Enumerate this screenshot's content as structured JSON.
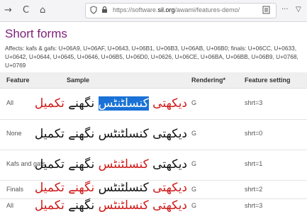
{
  "browser": {
    "back_glyph": "→",
    "reload_glyph": "C",
    "home_glyph": "⌂",
    "url_prefix": "https://software.",
    "url_domain": "sil.org",
    "url_path": "/awami/features-demo/",
    "menu_glyph": "···",
    "pocket_glyph": "▽"
  },
  "page": {
    "title": "Short forms",
    "affects": "Affects: kafs & gafs: U+06A9, U+06AF, U+0643, U+06B1, U+06B3, U+06AB, U+06B0; finals: U+06CC, U+0633, U+0642, U+0644, U+0645, U+0646, U+06B5, U+06D0, U+0626, U+06CE, U+06BA, U+06BB, U+06B9, U+0768, U+0769"
  },
  "table": {
    "headers": [
      "Feature",
      "Sample",
      "Rendering*",
      "Feature setting"
    ],
    "rows": [
      {
        "feature": "All",
        "rendering": "G",
        "setting": "shrt=3"
      },
      {
        "feature": "None",
        "rendering": "G",
        "setting": "shrt=0"
      },
      {
        "feature": "Kafs and gafs",
        "rendering": "G",
        "setting": "shrt=1"
      },
      {
        "feature": "Finals",
        "rendering": "G",
        "setting": "shrt=2"
      },
      {
        "feature": "All",
        "rendering": "G",
        "setting": "shrt=3"
      }
    ]
  },
  "sample": {
    "word1": "دیکھتی",
    "word2": "کنسلٹنٹس",
    "word3": "نگھنے",
    "word4": "تکمیل"
  },
  "colors": {
    "accent": "#7d2079",
    "highlight": "#1a72d6",
    "red": "#d01818"
  }
}
